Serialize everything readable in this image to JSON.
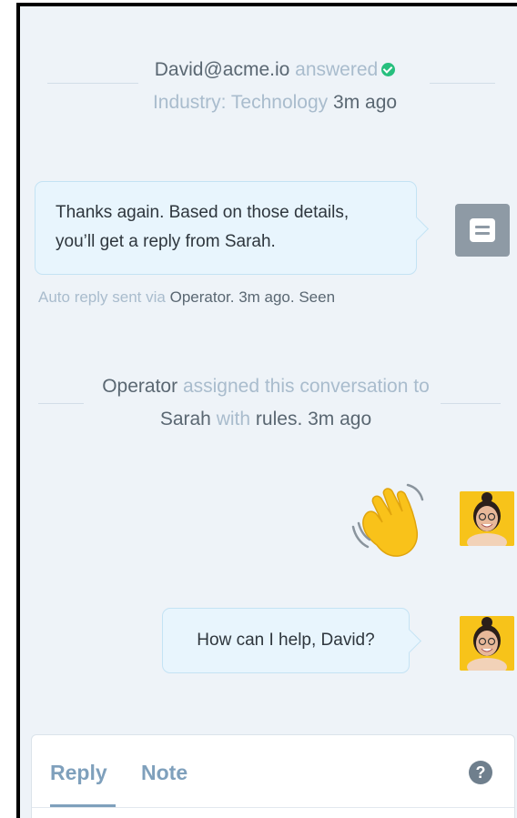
{
  "events": {
    "answered": {
      "email": "David@acme.io",
      "action": "answered",
      "detail": "Industry: Technology",
      "time": "3m ago"
    },
    "assigned": {
      "actor": "Operator",
      "action": "assigned this conversation to",
      "assignee": "Sarah",
      "with_text": "with",
      "rules": "rules.",
      "time": "3m ago"
    }
  },
  "auto_reply": {
    "line1": "Thanks again. Based on those details,",
    "line2": "you’ll get a reply from Sarah.",
    "meta_prefix": "Auto reply sent via",
    "meta_source": "Operator. 3m ago. Seen"
  },
  "wave_emoji": "👋",
  "agent_message": {
    "text": "How can I help, David?"
  },
  "composer": {
    "tabs": [
      "Reply",
      "Note"
    ],
    "help": "?"
  },
  "colors": {
    "background": "#eef3f8",
    "bubble": "#e8f5fd",
    "muted_text": "#a9bccd",
    "check": "#27bf7e",
    "tab": "#7fa0bc"
  }
}
